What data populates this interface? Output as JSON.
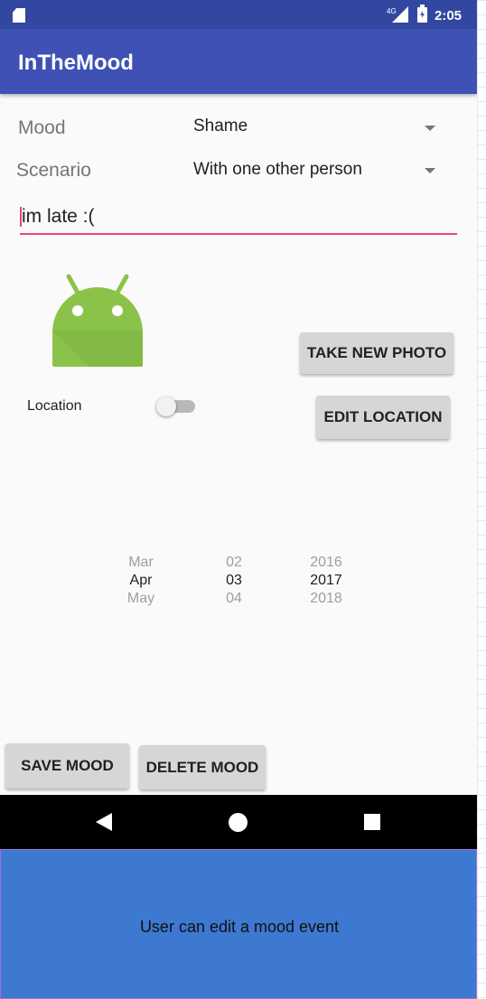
{
  "status_bar": {
    "time": "2:05",
    "network_label": "4G"
  },
  "app_bar": {
    "title": "InTheMood"
  },
  "form": {
    "mood_label": "Mood",
    "mood_value": "Shame",
    "scenario_label": "Scenario",
    "scenario_value": "With one other person",
    "note_value": "im late :(",
    "location_label": "Location",
    "location_enabled": false
  },
  "buttons": {
    "take_photo": "TAKE NEW PHOTO",
    "edit_location": "EDIT LOCATION",
    "save_mood": "SAVE MOOD",
    "delete_mood": "DELETE MOOD"
  },
  "date_picker": {
    "month": {
      "prev": "Mar",
      "selected": "Apr",
      "next": "May"
    },
    "day": {
      "prev": "02",
      "selected": "03",
      "next": "04"
    },
    "year": {
      "prev": "2016",
      "selected": "2017",
      "next": "2018"
    }
  },
  "caption": "User can edit a mood event",
  "colors": {
    "primary": "#3f51b5",
    "primary_dark": "#3248a0",
    "accent": "#e8457f",
    "android_green": "#8bc34a",
    "caption_bg": "#3d78d1"
  }
}
